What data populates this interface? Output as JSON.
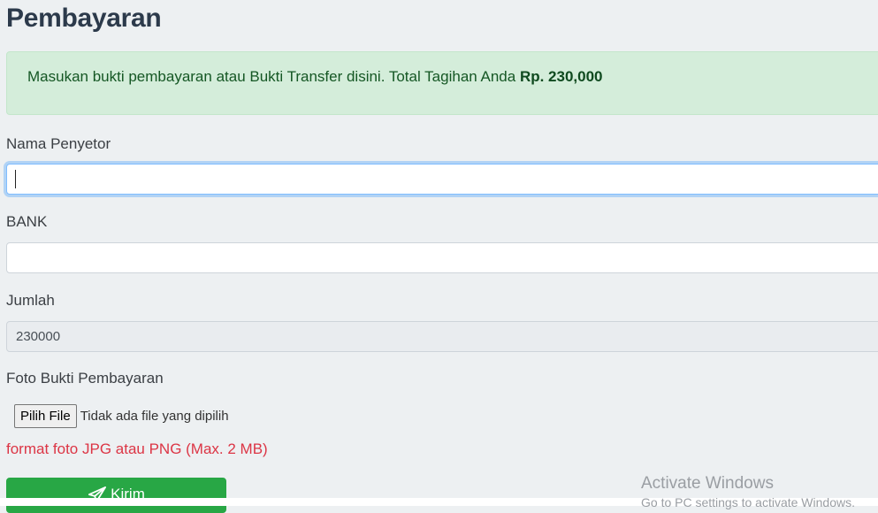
{
  "page": {
    "title": "Pembayaran"
  },
  "alert": {
    "message": "Masukan bukti pembayaran atau Bukti Transfer disini. Total Tagihan Anda ",
    "amount": "Rp. 230,000"
  },
  "form": {
    "name_label": "Nama Penyetor",
    "name_value": "",
    "bank_label": "BANK",
    "bank_value": "",
    "amount_label": "Jumlah",
    "amount_value": "230000",
    "photo_label": "Foto Bukti Pembayaran",
    "file_button_label": "Pilih File",
    "file_status": "Tidak ada file yang dipilih",
    "format_hint": "format foto JPG atau PNG (Max. 2 MB)",
    "submit_label": "Kirim",
    "submit_icon": "paper-plane-icon"
  },
  "watermark": {
    "title": "Activate Windows",
    "subtitle": "Go to PC settings to activate Windows."
  },
  "colors": {
    "alert_bg": "#d4edda",
    "alert_text": "#155724",
    "submit_bg": "#28a745",
    "hint_text": "#dc3545",
    "focus_border": "#80bdff"
  }
}
